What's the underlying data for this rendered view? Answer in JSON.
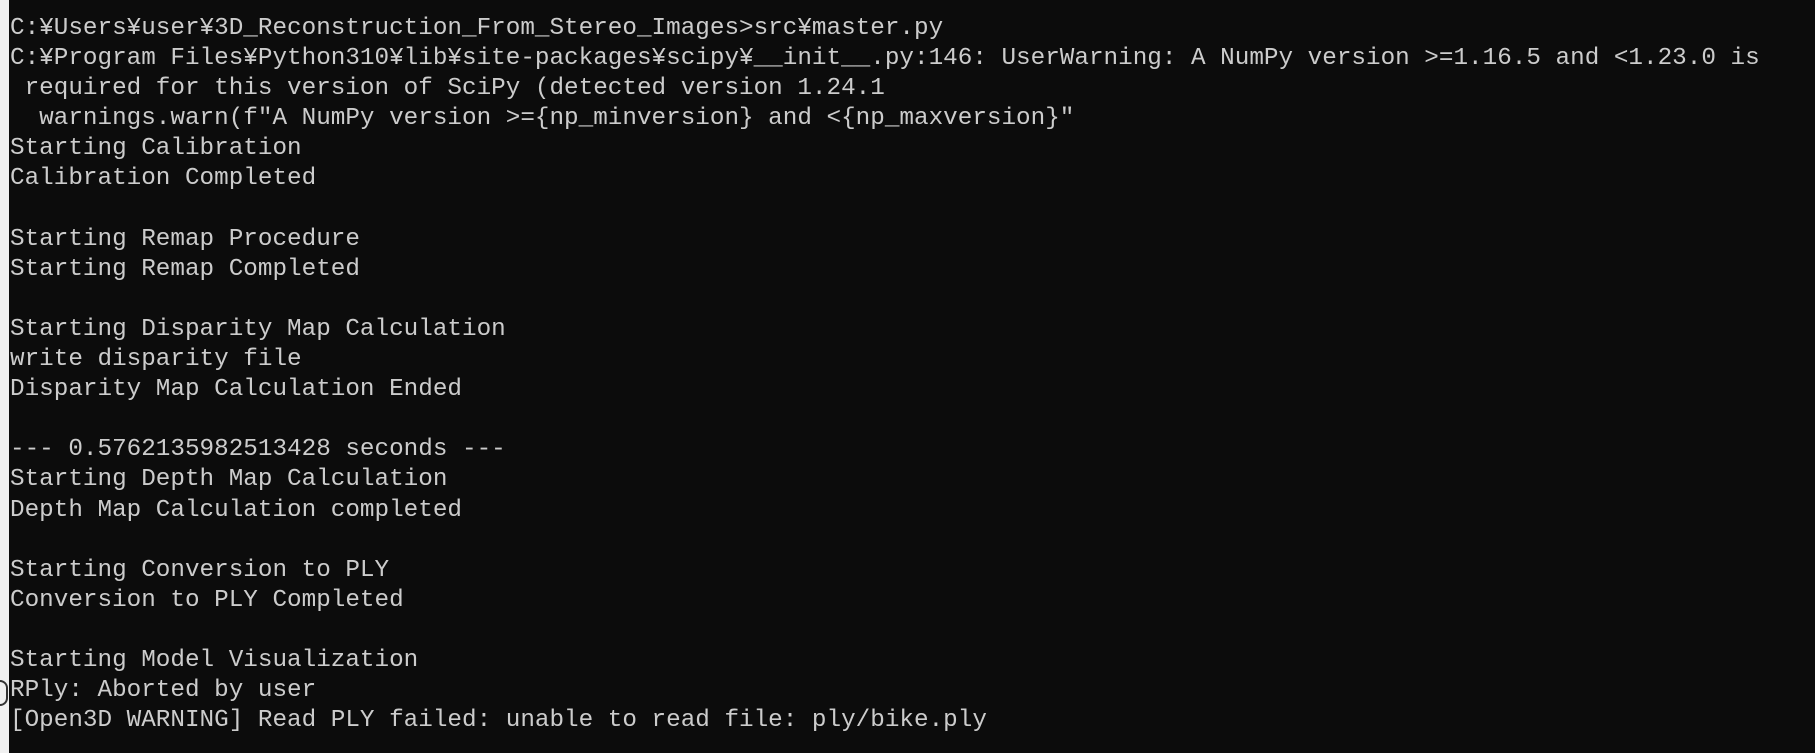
{
  "console": {
    "lines": [
      "C:¥Users¥user¥3D_Reconstruction_From_Stereo_Images>src¥master.py",
      "C:¥Program Files¥Python310¥lib¥site-packages¥scipy¥__init__.py:146: UserWarning: A NumPy version >=1.16.5 and <1.23.0 is",
      " required for this version of SciPy (detected version 1.24.1",
      "  warnings.warn(f\"A NumPy version >={np_minversion} and <{np_maxversion}\"",
      "Starting Calibration",
      "Calibration Completed",
      "",
      "Starting Remap Procedure",
      "Starting Remap Completed",
      "",
      "Starting Disparity Map Calculation",
      "write disparity file",
      "Disparity Map Calculation Ended",
      "",
      "--- 0.5762135982513428 seconds ---",
      "Starting Depth Map Calculation",
      "Depth Map Calculation completed",
      "",
      "Starting Conversion to PLY",
      "Conversion to PLY Completed",
      "",
      "Starting Model Visualization",
      "RPly: Aborted by user",
      "[Open3D WARNING] Read PLY failed: unable to read file: ply/bike.ply"
    ]
  },
  "colors": {
    "background": "#0c0c0c",
    "text": "#cccccc"
  }
}
